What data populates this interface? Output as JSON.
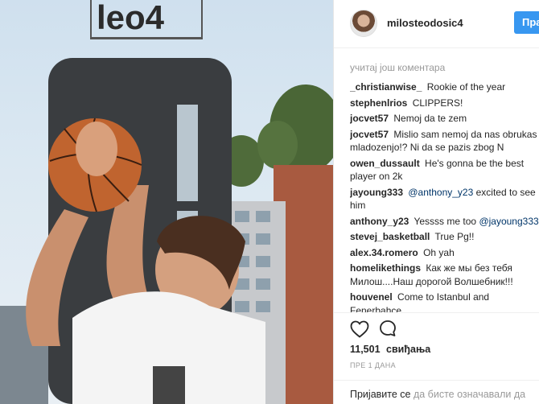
{
  "header": {
    "username": "milosteodosic4",
    "follow_label": "Пра"
  },
  "comments": {
    "load_more": "учитај још коментара",
    "items": [
      {
        "author": "_christianwise_",
        "text": "Rookie of the year"
      },
      {
        "author": "stephenlrios",
        "text": "CLIPPERS!"
      },
      {
        "author": "jocvet57",
        "text": "Nemoj da te zem"
      },
      {
        "author": "jocvet57",
        "text": "Mislio sam nemoj da nas obrukas mladozenjo!? Ni da se pazis zbog N"
      },
      {
        "author": "owen_dussault",
        "text": "He's gonna be the best player on 2k"
      },
      {
        "author": "jayoung333",
        "mention": "@anthony_y23",
        "text": "excited to see him"
      },
      {
        "author": "anthony_y23",
        "text": "Yessss me too",
        "mention": "@jayoung333"
      },
      {
        "author": "stevej_basketball",
        "text": "True Pg!!"
      },
      {
        "author": "alex.34.romero",
        "text": "Oh yah"
      },
      {
        "author": "homelikethings",
        "text": "Как же мы без тебя Милош....Наш дорогой Волшебник!!!"
      },
      {
        "author": "houvenel",
        "text": "Come to Istanbul and Fenerbahce"
      }
    ]
  },
  "actions": {
    "like_icon": "heart-icon",
    "comment_icon": "comment-icon"
  },
  "likes": {
    "count": "11,501",
    "label": "свиђања"
  },
  "time": "ПРЕ 1 ДАНА",
  "login_bar": {
    "link": "Пријавите се",
    "text": "да бисте означавали да"
  },
  "photo": {
    "sign_text": "leo4"
  },
  "colors": {
    "accent": "#3897f0",
    "text": "#262626",
    "muted": "#999999",
    "mention": "#003569"
  }
}
